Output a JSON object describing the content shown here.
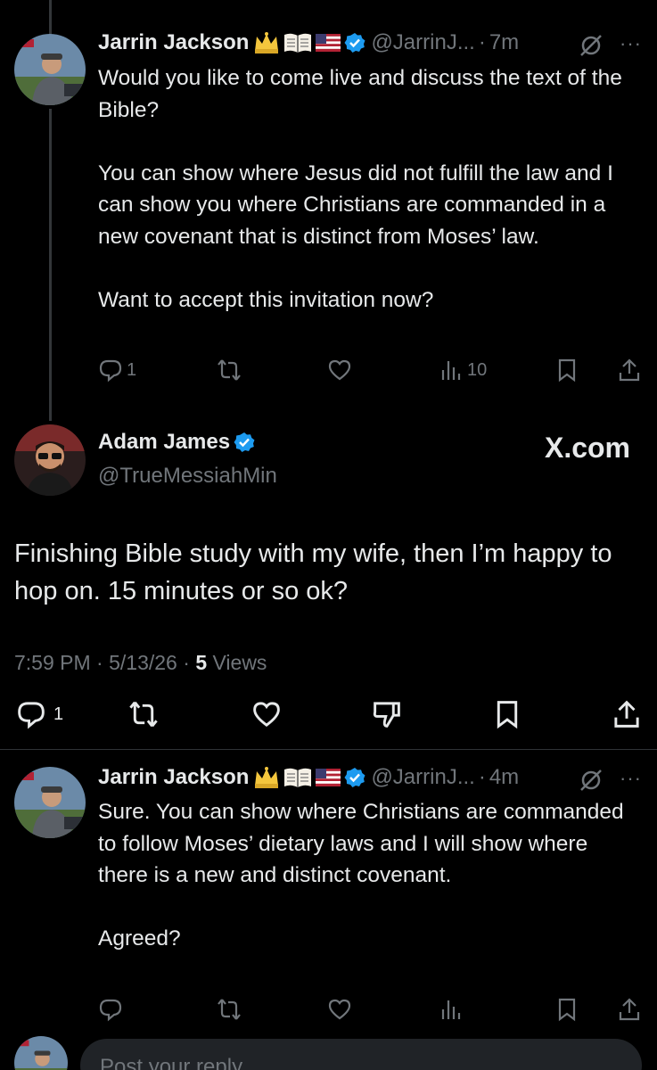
{
  "thread": [
    {
      "name": "Jarrin Jackson",
      "emoji": [
        "crown",
        "open-book",
        "us-flag"
      ],
      "handle": "@JarrinJ...",
      "time": "7m",
      "text": "Would you like to come live and discuss the text of the Bible?\n\nYou can show where Jesus did not fulfill the law and I can show you where Christians are commanded in a new covenant that is distinct from Moses’ law.\n\nWant to accept this invitation now?",
      "replies": "1",
      "views": "10"
    },
    {
      "name": "Jarrin Jackson",
      "emoji": [
        "crown",
        "open-book",
        "us-flag"
      ],
      "handle": "@JarrinJ...",
      "time": "4m",
      "text": "Sure. You can show where Christians are commanded to follow Moses’ dietary laws and I will show where there is a new and distinct covenant.\n\nAgreed?",
      "replies": "",
      "views": ""
    }
  ],
  "main_post": {
    "name": "Adam James",
    "handle": "@TrueMessiahMin",
    "watermark": "X.com",
    "text": "Finishing Bible study with my wife, then I’m happy to hop on. 15 minutes or so ok?",
    "time": "7:59 PM",
    "date": "5/13/26",
    "views_count": "5",
    "views_label": "Views",
    "replies": "1"
  },
  "reply_bar": {
    "placeholder": "Post your reply"
  },
  "colors": {
    "background": "#000000",
    "text": "#e7e9ea",
    "muted": "#71767b",
    "verified": "#1d9bf0",
    "divider": "#2f3336"
  }
}
